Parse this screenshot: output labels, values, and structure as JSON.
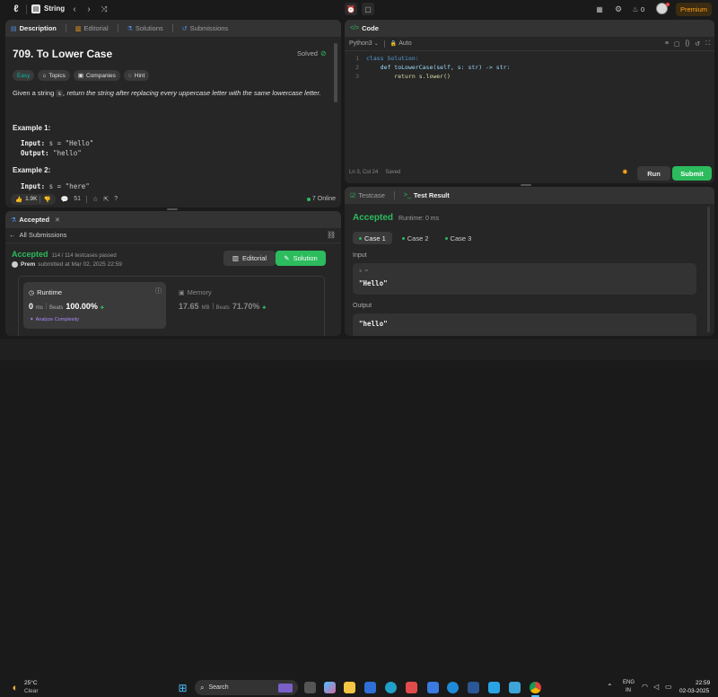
{
  "topbar": {
    "title": "String",
    "coins": "0",
    "premium_label": "Premium"
  },
  "problem_panel": {
    "tabs": [
      {
        "label": "Description"
      },
      {
        "label": "Editorial"
      },
      {
        "label": "Solutions"
      },
      {
        "label": "Submissions"
      }
    ],
    "title": "709. To Lower Case",
    "status": "Solved",
    "tags": [
      "Easy",
      "Topics",
      "Companies",
      "Hint"
    ],
    "desc_prefix": "Given a string ",
    "desc_code": "s",
    "desc_suffix": ", return the string after replacing every uppercase letter with the same lowercase letter.",
    "example1_heading": "Example 1:",
    "ex1_input_label": "Input:",
    "ex1_input_value": "s = \"Hello\"",
    "ex1_output_label": "Output:",
    "ex1_output_value": "\"hello\"",
    "example2_heading": "Example 2:",
    "ex2_input_label": "Input:",
    "ex2_input_value": "s = \"here\"",
    "likes": "1.9K",
    "comments": "51",
    "online": "7 Online"
  },
  "accepted_panel": {
    "tab_label": "Accepted",
    "all_submissions": "All Submissions",
    "status": "Accepted",
    "testcases": "114 / 114 testcases passed",
    "user": "Prem",
    "submitted_at": "submitted at Mar 02, 2025 22:59",
    "editorial_btn": "Editorial",
    "solution_btn": "Solution",
    "runtime_label": "Runtime",
    "runtime_value": "0",
    "runtime_unit": "ms",
    "runtime_beats_label": "Beats",
    "runtime_beats": "100.00%",
    "analyze": "Analyze Complexity",
    "memory_label": "Memory",
    "memory_value": "17.65",
    "memory_unit": "MB",
    "memory_beats_label": "Beats",
    "memory_beats": "71.70%"
  },
  "code_panel": {
    "tab_label": "Code",
    "language": "Python3",
    "auto_label": "Auto",
    "lines": [
      {
        "num": "1",
        "text": "class Solution:"
      },
      {
        "num": "2",
        "text": "    def toLowerCase(self, s: str) -> str:"
      },
      {
        "num": "3",
        "text": "        return s.lower()"
      }
    ],
    "cursor": "Ln 3, Col 24",
    "saved": "Saved",
    "run_label": "Run",
    "submit_label": "Submit"
  },
  "result_panel": {
    "testcase_tab": "Testcase",
    "result_tab": "Test Result",
    "status": "Accepted",
    "runtime": "Runtime: 0 ms",
    "cases": [
      "Case 1",
      "Case 2",
      "Case 3"
    ],
    "input_label": "Input",
    "input_var": "s =",
    "input_value": "\"Hello\"",
    "output_label": "Output",
    "output_value": "\"hello\""
  },
  "taskbar": {
    "temp": "25°C",
    "weather": "Clear",
    "search_placeholder": "Search",
    "lang_top": "ENG",
    "lang_bottom": "IN",
    "time": "22:59",
    "date": "02-03-2025"
  },
  "colors": {
    "accent_green": "#2cbb5d",
    "premium": "#ffa116",
    "easy": "#00b8a3"
  }
}
